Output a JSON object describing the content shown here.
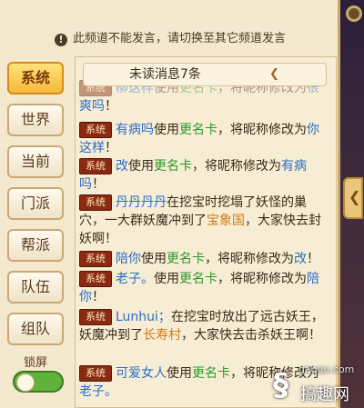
{
  "notice": {
    "text": "此频道不能发言，请切换至其它频道发言"
  },
  "tabs": [
    "系统",
    "世界",
    "当前",
    "门派",
    "帮派",
    "队伍",
    "组队"
  ],
  "lock": {
    "label": "锁屏"
  },
  "unread": {
    "text": "未读消息7条"
  },
  "badge": "系统",
  "messages": {
    "m0": {
      "a": "柳这样",
      "b": "使用",
      "c": "更名卡",
      "d": "，将昵称修改为",
      "e": "很",
      "f": "爽吗",
      "g": "！"
    },
    "m1": {
      "a": "有病吗",
      "b": "使用",
      "c": "更名卡",
      "d": "，将昵称修改为",
      "e": "你这样",
      "f": "！"
    },
    "m2": {
      "a": "改",
      "b": "使用",
      "c": "更名卡",
      "d": "，将昵称修改为",
      "e": "有病吗",
      "f": "！"
    },
    "m3": {
      "a": "丹丹丹丹",
      "b": "在挖宝时挖塌了妖怪的巢穴，一大群妖魔冲到了",
      "c": "宝象国",
      "d": "，大家快去封妖啊！"
    },
    "m4": {
      "a": "陪你",
      "b": "使用",
      "c": "更名卡",
      "d": "，将昵称修改为",
      "e": "改",
      "f": "！"
    },
    "m5": {
      "a": "老子。",
      "b": "使用",
      "c": "更名卡",
      "d": "，将昵称修改为",
      "e": "陪你",
      "f": "！"
    },
    "m6": {
      "a": "Lunhui；",
      "b": "在挖宝时放出了远古妖王，妖魔冲到了",
      "c": "长寿村",
      "d": "，大家快去击杀妖王啊！"
    },
    "m7": {
      "a": "可爱女人",
      "b": "使用",
      "c": "更名卡",
      "d": "，将昵称修改为",
      "e": "老子。"
    }
  },
  "watermark": {
    "url": "gaoqu.com",
    "name": "搞趣网"
  }
}
